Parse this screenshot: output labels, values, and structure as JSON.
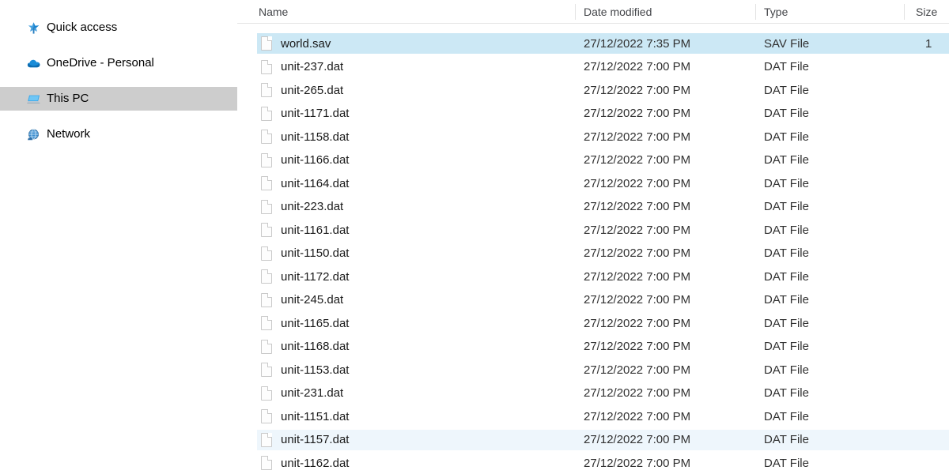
{
  "sidebar": {
    "items": [
      {
        "label": "Quick access",
        "icon": "pin-star-icon",
        "selected": false
      },
      {
        "label": "OneDrive - Personal",
        "icon": "cloud-icon",
        "selected": false
      },
      {
        "label": "This PC",
        "icon": "monitor-icon",
        "selected": true
      },
      {
        "label": "Network",
        "icon": "network-icon",
        "selected": false
      }
    ]
  },
  "file_list": {
    "columns": [
      {
        "key": "name",
        "label": "Name"
      },
      {
        "key": "date",
        "label": "Date modified"
      },
      {
        "key": "type",
        "label": "Type"
      },
      {
        "key": "size",
        "label": "Size"
      }
    ],
    "rows": [
      {
        "name": "world.sav",
        "date": "27/12/2022 7:35 PM",
        "type": "SAV File",
        "size": "1",
        "state": "selected"
      },
      {
        "name": "unit-237.dat",
        "date": "27/12/2022 7:00 PM",
        "type": "DAT File",
        "size": "",
        "state": ""
      },
      {
        "name": "unit-265.dat",
        "date": "27/12/2022 7:00 PM",
        "type": "DAT File",
        "size": "",
        "state": ""
      },
      {
        "name": "unit-1171.dat",
        "date": "27/12/2022 7:00 PM",
        "type": "DAT File",
        "size": "",
        "state": ""
      },
      {
        "name": "unit-1158.dat",
        "date": "27/12/2022 7:00 PM",
        "type": "DAT File",
        "size": "",
        "state": ""
      },
      {
        "name": "unit-1166.dat",
        "date": "27/12/2022 7:00 PM",
        "type": "DAT File",
        "size": "",
        "state": ""
      },
      {
        "name": "unit-1164.dat",
        "date": "27/12/2022 7:00 PM",
        "type": "DAT File",
        "size": "",
        "state": ""
      },
      {
        "name": "unit-223.dat",
        "date": "27/12/2022 7:00 PM",
        "type": "DAT File",
        "size": "",
        "state": ""
      },
      {
        "name": "unit-1161.dat",
        "date": "27/12/2022 7:00 PM",
        "type": "DAT File",
        "size": "",
        "state": ""
      },
      {
        "name": "unit-1150.dat",
        "date": "27/12/2022 7:00 PM",
        "type": "DAT File",
        "size": "",
        "state": ""
      },
      {
        "name": "unit-1172.dat",
        "date": "27/12/2022 7:00 PM",
        "type": "DAT File",
        "size": "",
        "state": ""
      },
      {
        "name": "unit-245.dat",
        "date": "27/12/2022 7:00 PM",
        "type": "DAT File",
        "size": "",
        "state": ""
      },
      {
        "name": "unit-1165.dat",
        "date": "27/12/2022 7:00 PM",
        "type": "DAT File",
        "size": "",
        "state": ""
      },
      {
        "name": "unit-1168.dat",
        "date": "27/12/2022 7:00 PM",
        "type": "DAT File",
        "size": "",
        "state": ""
      },
      {
        "name": "unit-1153.dat",
        "date": "27/12/2022 7:00 PM",
        "type": "DAT File",
        "size": "",
        "state": ""
      },
      {
        "name": "unit-231.dat",
        "date": "27/12/2022 7:00 PM",
        "type": "DAT File",
        "size": "",
        "state": ""
      },
      {
        "name": "unit-1151.dat",
        "date": "27/12/2022 7:00 PM",
        "type": "DAT File",
        "size": "",
        "state": ""
      },
      {
        "name": "unit-1157.dat",
        "date": "27/12/2022 7:00 PM",
        "type": "DAT File",
        "size": "",
        "state": "hover"
      },
      {
        "name": "unit-1162.dat",
        "date": "27/12/2022 7:00 PM",
        "type": "DAT File",
        "size": "",
        "state": ""
      }
    ]
  },
  "colors": {
    "selection_blue": "#cce8f5",
    "hover_blue": "#eef6fc",
    "sidebar_selection_gray": "#cdcdcd",
    "header_text": "#44464a"
  }
}
